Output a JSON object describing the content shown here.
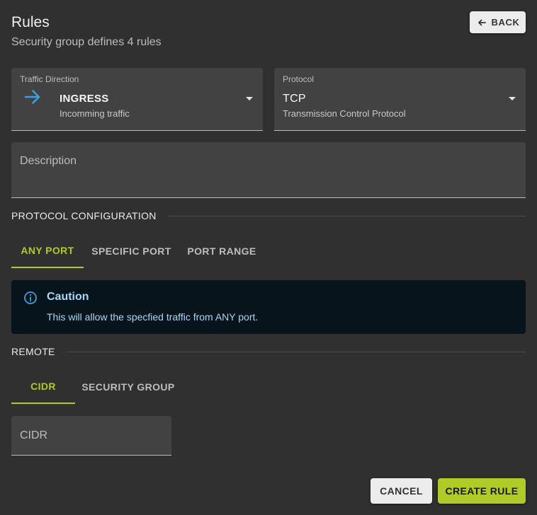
{
  "header": {
    "title": "Rules",
    "subtitle": "Security group defines 4 rules",
    "back_label": "BACK"
  },
  "traffic_direction": {
    "label": "Traffic Direction",
    "value": "INGRESS",
    "description": "Incomming traffic",
    "icon": "arrow-right-icon"
  },
  "protocol": {
    "label": "Protocol",
    "value": "TCP",
    "description": "Transmission Control Protocol"
  },
  "description_field": {
    "placeholder": "Description",
    "value": ""
  },
  "protocol_configuration": {
    "title": "PROTOCOL CONFIGURATION",
    "tabs": [
      {
        "label": "ANY PORT",
        "active": true
      },
      {
        "label": "SPECIFIC PORT",
        "active": false
      },
      {
        "label": "PORT RANGE",
        "active": false
      }
    ],
    "alert": {
      "title": "Caution",
      "message": "This will allow the specfied traffic from ANY port."
    }
  },
  "remote": {
    "title": "REMOTE",
    "tabs": [
      {
        "label": "CIDR",
        "active": true
      },
      {
        "label": "SECURITY GROUP",
        "active": false
      }
    ],
    "cidr_field": {
      "placeholder": "CIDR",
      "value": ""
    }
  },
  "actions": {
    "cancel_label": "CANCEL",
    "create_label": "CREATE RULE"
  },
  "colors": {
    "background": "#303030",
    "field_background": "#424242",
    "accent": "#aecb28",
    "info_text": "#a7d8f5",
    "info_background": "#07141b",
    "arrow_icon": "#3aa0e0"
  }
}
